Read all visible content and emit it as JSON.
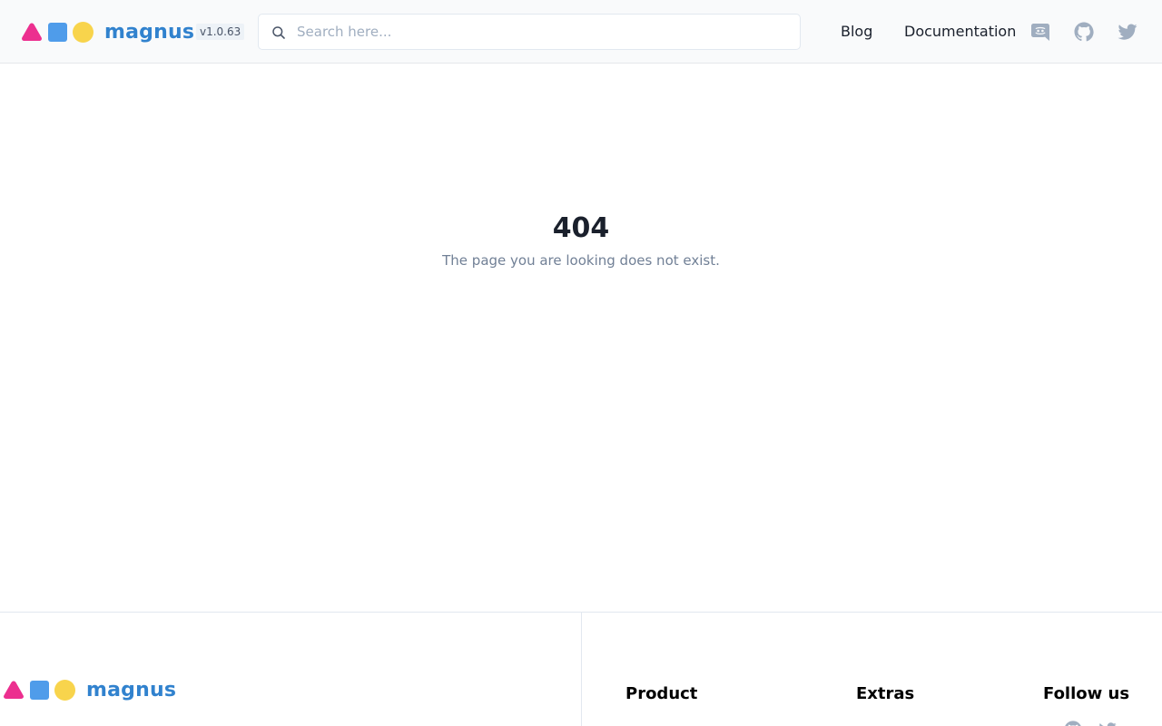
{
  "header": {
    "brand": "magnus",
    "version": "v1.0.63",
    "search": {
      "placeholder": "Search here...",
      "value": "",
      "icon": "search-icon"
    },
    "nav": [
      {
        "label": "Blog"
      },
      {
        "label": "Documentation"
      }
    ],
    "social": [
      "discord-icon",
      "github-icon",
      "twitter-icon"
    ]
  },
  "main": {
    "code": "404",
    "message": "The page you are looking does not exist."
  },
  "footer": {
    "brand": "magnus",
    "columns": [
      {
        "title": "Product"
      },
      {
        "title": "Extras"
      },
      {
        "title": "Follow us"
      }
    ],
    "social": [
      "github-icon",
      "twitter-icon"
    ]
  },
  "colors": {
    "brand": "#3182ce",
    "logo_triangle": "#ec2f8f",
    "logo_square": "#4f9cea",
    "logo_circle": "#f8d44c",
    "header_bg": "#f9fafb",
    "icon_gray": "#a0aec0",
    "muted_text": "#718096"
  }
}
